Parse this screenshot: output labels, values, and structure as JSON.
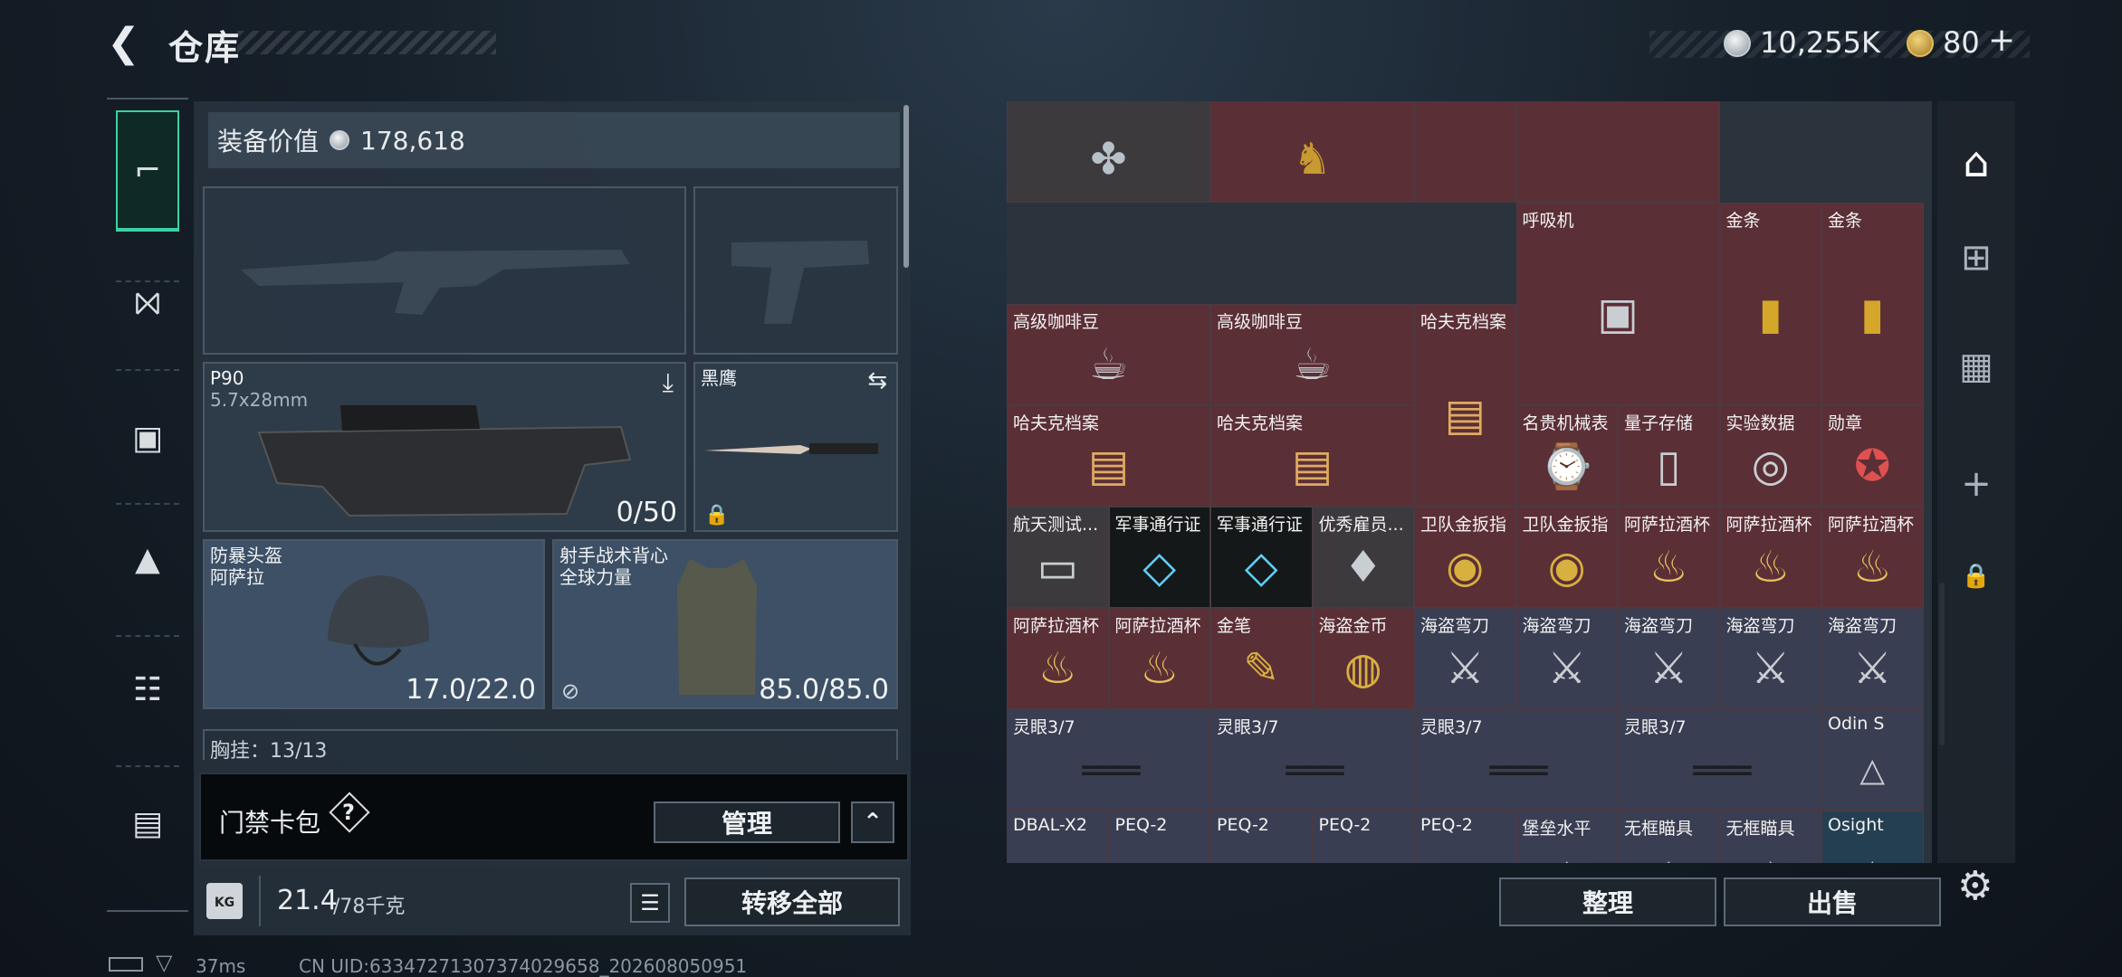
{
  "header": {
    "title": "仓库",
    "back_icon": "back-arrow-icon",
    "currency": {
      "silver": "10,255K",
      "gold": "80",
      "plus": "+"
    }
  },
  "left_nav": [
    {
      "icon": "pistol-icon",
      "active": true
    },
    {
      "icon": "chest-rig-icon"
    },
    {
      "icon": "backpack-icon"
    },
    {
      "icon": "bag-icon"
    },
    {
      "icon": "clipboard-icon"
    },
    {
      "icon": "briefcase-icon"
    }
  ],
  "equipment": {
    "value_label": "装备价值",
    "value": "178,618",
    "primary": {
      "name": "P90",
      "ammo": "5.7x28mm",
      "count": "0/50"
    },
    "knife": {
      "name": "黑鹰"
    },
    "helmet": {
      "name": "防暴头盔",
      "sub": "阿萨拉",
      "dur": "17.0/22.0"
    },
    "armor": {
      "name": "射手战术背心",
      "sub": "全球力量",
      "dur": "85.0/85.0"
    },
    "next_row": "胸挂：13/13"
  },
  "access": {
    "label": "门禁卡包",
    "help": "?",
    "manage": "管理"
  },
  "weight": {
    "value": "21.4",
    "max": "/78千克",
    "transfer_all": "转移全部"
  },
  "storage": {
    "organize": "整理",
    "sell": "出售"
  },
  "status": {
    "ping": "37ms",
    "uid": "CN UID:633472713073740296​58_202608050951"
  },
  "colors": {
    "accent": "#3cd1a3",
    "item_red": "#5b2f36",
    "item_blue": "#3a3e52"
  },
  "items": [
    {
      "label": "",
      "cls": "dark",
      "c": 0,
      "r": 0,
      "w": 2,
      "h": 1,
      "icon": "necklace"
    },
    {
      "label": "",
      "cls": "red",
      "c": 2,
      "r": 0,
      "w": 2,
      "h": 1,
      "icon": "horse-statue"
    },
    {
      "label": "",
      "cls": "red",
      "c": 4,
      "r": 0,
      "w": 1,
      "h": 1,
      "icon": ""
    },
    {
      "label": "",
      "cls": "red",
      "c": 5,
      "r": 0,
      "w": 2,
      "h": 1,
      "icon": ""
    },
    {
      "label": "呼吸机",
      "cls": "red",
      "c": 5,
      "r": 1,
      "w": 2,
      "h": 2,
      "icon": "ventilator"
    },
    {
      "label": "金条",
      "cls": "red",
      "c": 7,
      "r": 1,
      "w": 1,
      "h": 2,
      "icon": "gold-bar"
    },
    {
      "label": "金条",
      "cls": "red",
      "c": 8,
      "r": 1,
      "w": 1,
      "h": 2,
      "icon": "gold-bar"
    },
    {
      "label": "高级咖啡豆",
      "cls": "red",
      "c": 0,
      "r": 2,
      "w": 2,
      "h": 1,
      "icon": "coffee"
    },
    {
      "label": "高级咖啡豆",
      "cls": "red",
      "c": 2,
      "r": 2,
      "w": 2,
      "h": 1,
      "icon": "coffee"
    },
    {
      "label": "哈夫克档案",
      "cls": "red",
      "c": 4,
      "r": 2,
      "w": 1,
      "h": 2,
      "icon": "file"
    },
    {
      "label": "哈夫克档案",
      "cls": "red",
      "c": 0,
      "r": 3,
      "w": 2,
      "h": 1,
      "icon": "file"
    },
    {
      "label": "哈夫克档案",
      "cls": "red",
      "c": 2,
      "r": 3,
      "w": 2,
      "h": 1,
      "icon": "file"
    },
    {
      "label": "名贵机械表",
      "cls": "red",
      "c": 5,
      "r": 3,
      "w": 1,
      "h": 1,
      "icon": "watch"
    },
    {
      "label": "量子存储",
      "cls": "red",
      "c": 6,
      "r": 3,
      "w": 1,
      "h": 1,
      "icon": "usb"
    },
    {
      "label": "实验数据",
      "cls": "red",
      "c": 7,
      "r": 3,
      "w": 1,
      "h": 1,
      "icon": "disc"
    },
    {
      "label": "勋章",
      "cls": "red",
      "c": 8,
      "r": 3,
      "w": 1,
      "h": 1,
      "icon": "medal"
    },
    {
      "label": "航天测试...",
      "cls": "dark",
      "c": 0,
      "r": 4,
      "w": 1,
      "h": 1,
      "icon": "card"
    },
    {
      "label": "军事通行证",
      "cls": "mil",
      "c": 1,
      "r": 4,
      "w": 1,
      "h": 1,
      "icon": "pass"
    },
    {
      "label": "军事通行证",
      "cls": "mil",
      "c": 2,
      "r": 4,
      "w": 1,
      "h": 1,
      "icon": "pass"
    },
    {
      "label": "优秀雇员...",
      "cls": "dark",
      "c": 3,
      "r": 4,
      "w": 1,
      "h": 1,
      "icon": "trophy"
    },
    {
      "label": "卫队金扳指",
      "cls": "red",
      "c": 4,
      "r": 4,
      "w": 1,
      "h": 1,
      "icon": "ring"
    },
    {
      "label": "卫队金扳指",
      "cls": "red",
      "c": 5,
      "r": 4,
      "w": 1,
      "h": 1,
      "icon": "ring"
    },
    {
      "label": "阿萨拉酒杯",
      "cls": "red",
      "c": 6,
      "r": 4,
      "w": 1,
      "h": 1,
      "icon": "cup"
    },
    {
      "label": "阿萨拉酒杯",
      "cls": "red",
      "c": 7,
      "r": 4,
      "w": 1,
      "h": 1,
      "icon": "cup"
    },
    {
      "label": "阿萨拉酒杯",
      "cls": "red",
      "c": 8,
      "r": 4,
      "w": 1,
      "h": 1,
      "icon": "cup"
    },
    {
      "label": "阿萨拉酒杯",
      "cls": "red",
      "c": 0,
      "r": 5,
      "w": 1,
      "h": 1,
      "icon": "cup"
    },
    {
      "label": "阿萨拉酒杯",
      "cls": "red",
      "c": 1,
      "r": 5,
      "w": 1,
      "h": 1,
      "icon": "cup"
    },
    {
      "label": "金笔",
      "cls": "red",
      "c": 2,
      "r": 5,
      "w": 1,
      "h": 1,
      "icon": "pen"
    },
    {
      "label": "海盗金币",
      "cls": "red",
      "c": 3,
      "r": 5,
      "w": 1,
      "h": 1,
      "icon": "coin"
    },
    {
      "label": "海盗弯刀",
      "cls": "blue",
      "c": 4,
      "r": 5,
      "w": 1,
      "h": 1,
      "icon": "dagger"
    },
    {
      "label": "海盗弯刀",
      "cls": "blue",
      "c": 5,
      "r": 5,
      "w": 1,
      "h": 1,
      "icon": "dagger"
    },
    {
      "label": "海盗弯刀",
      "cls": "blue",
      "c": 6,
      "r": 5,
      "w": 1,
      "h": 1,
      "icon": "dagger"
    },
    {
      "label": "海盗弯刀",
      "cls": "blue",
      "c": 7,
      "r": 5,
      "w": 1,
      "h": 1,
      "icon": "dagger"
    },
    {
      "label": "海盗弯刀",
      "cls": "blue",
      "c": 8,
      "r": 5,
      "w": 1,
      "h": 1,
      "icon": "dagger"
    },
    {
      "label": "灵眼3/7",
      "cls": "blue",
      "c": 0,
      "r": 6,
      "w": 2,
      "h": 1,
      "icon": "scope"
    },
    {
      "label": "灵眼3/7",
      "cls": "blue",
      "c": 2,
      "r": 6,
      "w": 2,
      "h": 1,
      "icon": "scope"
    },
    {
      "label": "灵眼3/7",
      "cls": "blue",
      "c": 4,
      "r": 6,
      "w": 2,
      "h": 1,
      "icon": "scope"
    },
    {
      "label": "灵眼3/7",
      "cls": "blue",
      "c": 6,
      "r": 6,
      "w": 2,
      "h": 1,
      "icon": "scope"
    },
    {
      "label": "Odin S",
      "cls": "blue",
      "c": 8,
      "r": 6,
      "w": 1,
      "h": 1,
      "icon": "unknown"
    },
    {
      "label": "DBAL-X2",
      "cls": "blue",
      "c": 0,
      "r": 7,
      "w": 1,
      "h": 1,
      "icon": "laser"
    },
    {
      "label": "PEQ-2",
      "cls": "blue",
      "c": 1,
      "r": 7,
      "w": 1,
      "h": 1,
      "icon": "laser"
    },
    {
      "label": "PEQ-2",
      "cls": "blue",
      "c": 2,
      "r": 7,
      "w": 1,
      "h": 1,
      "icon": "laser"
    },
    {
      "label": "PEQ-2",
      "cls": "blue",
      "c": 3,
      "r": 7,
      "w": 1,
      "h": 1,
      "icon": "laser"
    },
    {
      "label": "PEQ-2",
      "cls": "blue",
      "c": 4,
      "r": 7,
      "w": 1,
      "h": 1,
      "icon": "laser"
    },
    {
      "label": "堡垒水平",
      "cls": "blue",
      "c": 5,
      "r": 7,
      "w": 1,
      "h": 1,
      "icon": "unknown"
    },
    {
      "label": "无框瞄具",
      "cls": "blue",
      "c": 6,
      "r": 7,
      "w": 1,
      "h": 1,
      "icon": "unknown"
    },
    {
      "label": "无框瞄具",
      "cls": "blue",
      "c": 7,
      "r": 7,
      "w": 1,
      "h": 1,
      "icon": "unknown"
    },
    {
      "label": "Osight",
      "cls": "sel",
      "c": 8,
      "r": 7,
      "w": 1,
      "h": 1,
      "icon": "unknown"
    }
  ]
}
